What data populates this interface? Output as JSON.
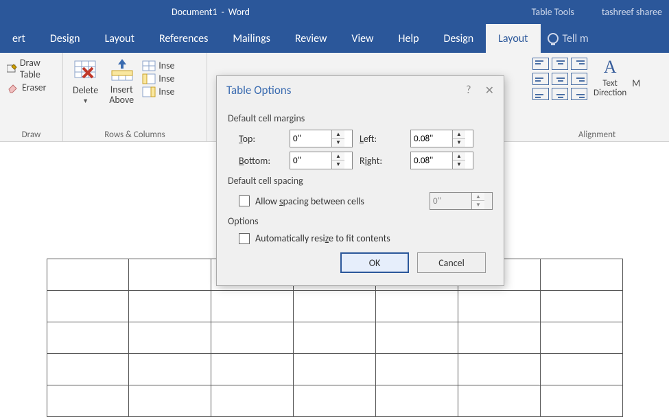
{
  "title": {
    "doc": "Document1",
    "sep": "-",
    "app": "Word",
    "table_tools": "Table Tools",
    "user": "tashreef sharee"
  },
  "menu": [
    "ert",
    "Design",
    "Layout",
    "References",
    "Mailings",
    "Review",
    "View",
    "Help",
    "Design",
    "Layout"
  ],
  "menu_tell": "Tell m",
  "ribbon": {
    "draw": {
      "draw_table": "Draw Table",
      "eraser": "Eraser",
      "group": "Draw"
    },
    "rowscols": {
      "delete": "Delete",
      "insert_above": "Insert Above",
      "inse1": "Inse",
      "inse2": "Inse",
      "inse3": "Inse",
      "group": "Rows & Columns"
    },
    "align": {
      "text_direction": "Text Direction",
      "m": "M",
      "group": "Alignment"
    }
  },
  "dialog": {
    "title": "Table Options",
    "sect_margins": "Default cell margins",
    "labels": {
      "top": "Top:",
      "bottom": "Bottom:",
      "left": "Left:",
      "right": "Right:"
    },
    "values": {
      "top": "0\"",
      "bottom": "0\"",
      "left": "0.08\"",
      "right": "0.08\"",
      "spacing": "0\""
    },
    "sect_spacing": "Default cell spacing",
    "allow_spacing": "Allow spacing between cells",
    "sect_options": "Options",
    "auto_resize": "Automatically resize to fit contents",
    "ok": "OK",
    "cancel": "Cancel"
  }
}
